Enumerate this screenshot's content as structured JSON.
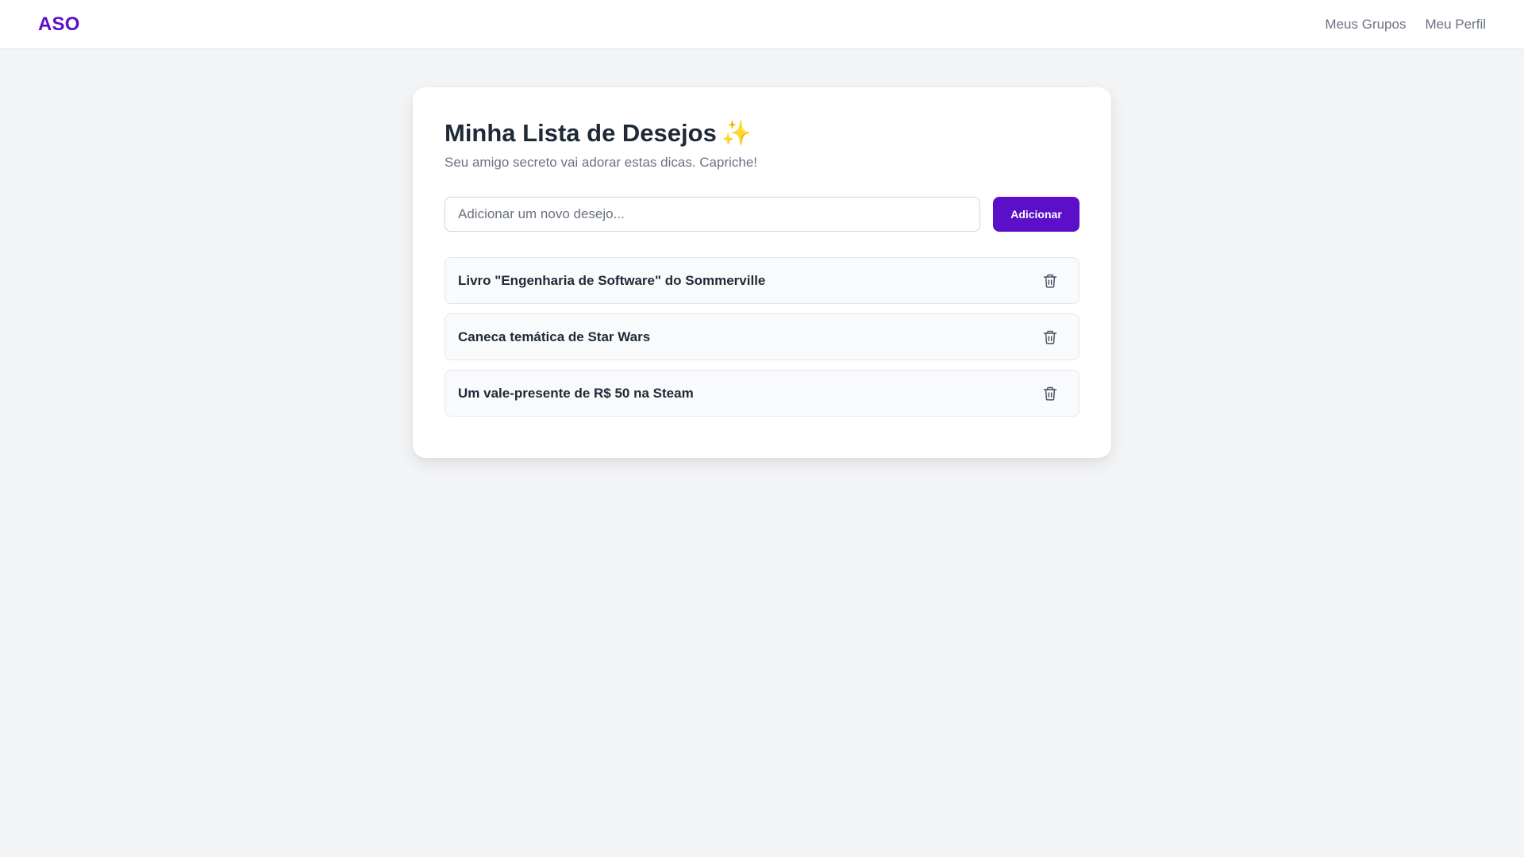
{
  "navbar": {
    "brand": "ASO",
    "links": [
      {
        "label": "Meus Grupos"
      },
      {
        "label": "Meu Perfil"
      }
    ]
  },
  "wishlist": {
    "title": "Minha Lista de Desejos",
    "title_emoji": "✨",
    "subtitle": "Seu amigo secreto vai adorar estas dicas. Capriche!",
    "input": {
      "placeholder": "Adicionar um novo desejo...",
      "value": ""
    },
    "add_label": "Adicionar",
    "items": [
      {
        "text": "Livro \"Engenharia de Software\" do Sommerville",
        "icon": "trash-icon"
      },
      {
        "text": "Caneca temática de Star Wars",
        "icon": "trash-icon"
      },
      {
        "text": "Um vale-presente de R$ 50 na Steam",
        "icon": "trash-icon"
      }
    ]
  },
  "colors": {
    "accent": "#5b0fc8",
    "background": "#f3f4f6",
    "card": "#ffffff",
    "text": "#1f2937",
    "muted": "#6b7280"
  }
}
